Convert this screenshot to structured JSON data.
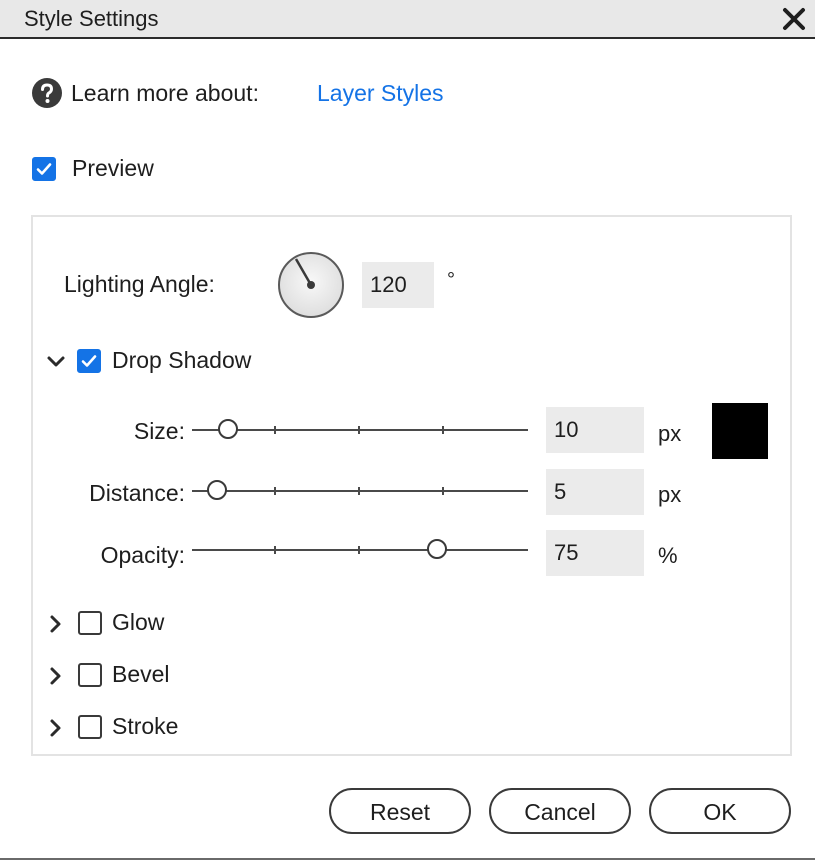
{
  "dialog": {
    "title": "Style Settings",
    "close_icon": "close-icon"
  },
  "help": {
    "icon": "help-icon",
    "label": "Learn more about:",
    "link_text": "Layer Styles"
  },
  "preview": {
    "label": "Preview",
    "checked": true
  },
  "lighting": {
    "label": "Lighting Angle:",
    "value": "120",
    "unit": "°"
  },
  "drop_shadow": {
    "label": "Drop Shadow",
    "checked": true,
    "expanded": true,
    "color": "#000000",
    "size": {
      "label": "Size:",
      "value": "10",
      "unit": "px"
    },
    "distance": {
      "label": "Distance:",
      "value": "5",
      "unit": "px"
    },
    "opacity": {
      "label": "Opacity:",
      "value": "75",
      "unit": "%"
    }
  },
  "effects": [
    {
      "label": "Glow",
      "checked": false,
      "expanded": false
    },
    {
      "label": "Bevel",
      "checked": false,
      "expanded": false
    },
    {
      "label": "Stroke",
      "checked": false,
      "expanded": false
    }
  ],
  "buttons": {
    "reset": "Reset",
    "cancel": "Cancel",
    "ok": "OK"
  },
  "colors": {
    "accent": "#1473e6",
    "field_bg": "#ebebeb",
    "titlebar_bg": "#e8e8e8"
  }
}
